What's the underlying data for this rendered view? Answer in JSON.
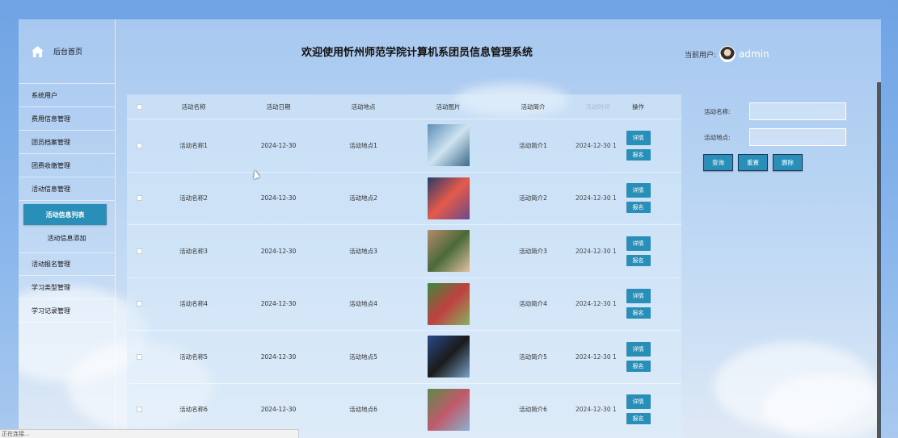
{
  "app": {
    "title": "欢迎使用忻州师范学院计算机系团员信息管理系统",
    "user_label": "当前用户:",
    "user_name": "admin"
  },
  "sidebar": {
    "home_label": "后台首页",
    "items": [
      {
        "label": "系统用户"
      },
      {
        "label": "费用信息管理"
      },
      {
        "label": "团员档案管理"
      },
      {
        "label": "团费收缴管理"
      },
      {
        "label": "活动信息管理"
      }
    ],
    "subitems": [
      {
        "label": "活动信息列表",
        "active": true
      },
      {
        "label": "活动信息添加",
        "active": false
      }
    ],
    "items_after": [
      {
        "label": "活动报名管理"
      },
      {
        "label": "学习类型管理"
      },
      {
        "label": "学习记录管理"
      }
    ]
  },
  "table": {
    "headers": {
      "name": "活动名称",
      "date": "活动日期",
      "location": "活动地点",
      "image": "活动图片",
      "intro": "活动简介",
      "time": "活动时间",
      "op": "操作"
    },
    "detail_label": "详情",
    "signup_label": "报名",
    "rows": [
      {
        "name": "活动名称1",
        "date": "2024-12-30",
        "location": "活动地点1",
        "intro": "活动简介1",
        "time": "2024-12-30 1"
      },
      {
        "name": "活动名称2",
        "date": "2024-12-30",
        "location": "活动地点2",
        "intro": "活动简介2",
        "time": "2024-12-30 1"
      },
      {
        "name": "活动名称3",
        "date": "2024-12-30",
        "location": "活动地点3",
        "intro": "活动简介3",
        "time": "2024-12-30 1"
      },
      {
        "name": "活动名称4",
        "date": "2024-12-30",
        "location": "活动地点4",
        "intro": "活动简介4",
        "time": "2024-12-30 1"
      },
      {
        "name": "活动名称5",
        "date": "2024-12-30",
        "location": "活动地点5",
        "intro": "活动简介5",
        "time": "2024-12-30 1"
      },
      {
        "name": "活动名称6",
        "date": "2024-12-30",
        "location": "活动地点6",
        "intro": "活动简介6",
        "time": "2024-12-30 1"
      }
    ],
    "overflow_text": "2024"
  },
  "search": {
    "name_label": "活动名称:",
    "location_label": "活动地点:",
    "query_label": "查询",
    "reset_label": "重置",
    "delete_label": "删除"
  },
  "status": {
    "text": "正在连接..."
  },
  "colors": {
    "accent": "#2a8fb8",
    "background": "#a8c8f0"
  }
}
